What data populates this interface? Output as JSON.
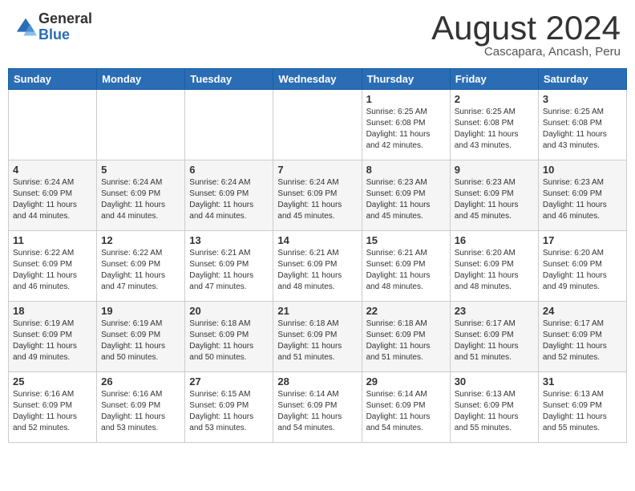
{
  "header": {
    "logo_line1": "General",
    "logo_line2": "Blue",
    "month_title": "August 2024",
    "subtitle": "Cascapara, Ancash, Peru"
  },
  "days_of_week": [
    "Sunday",
    "Monday",
    "Tuesday",
    "Wednesday",
    "Thursday",
    "Friday",
    "Saturday"
  ],
  "weeks": [
    [
      {
        "day": "",
        "info": ""
      },
      {
        "day": "",
        "info": ""
      },
      {
        "day": "",
        "info": ""
      },
      {
        "day": "",
        "info": ""
      },
      {
        "day": "1",
        "info": "Sunrise: 6:25 AM\nSunset: 6:08 PM\nDaylight: 11 hours\nand 42 minutes."
      },
      {
        "day": "2",
        "info": "Sunrise: 6:25 AM\nSunset: 6:08 PM\nDaylight: 11 hours\nand 43 minutes."
      },
      {
        "day": "3",
        "info": "Sunrise: 6:25 AM\nSunset: 6:08 PM\nDaylight: 11 hours\nand 43 minutes."
      }
    ],
    [
      {
        "day": "4",
        "info": "Sunrise: 6:24 AM\nSunset: 6:09 PM\nDaylight: 11 hours\nand 44 minutes."
      },
      {
        "day": "5",
        "info": "Sunrise: 6:24 AM\nSunset: 6:09 PM\nDaylight: 11 hours\nand 44 minutes."
      },
      {
        "day": "6",
        "info": "Sunrise: 6:24 AM\nSunset: 6:09 PM\nDaylight: 11 hours\nand 44 minutes."
      },
      {
        "day": "7",
        "info": "Sunrise: 6:24 AM\nSunset: 6:09 PM\nDaylight: 11 hours\nand 45 minutes."
      },
      {
        "day": "8",
        "info": "Sunrise: 6:23 AM\nSunset: 6:09 PM\nDaylight: 11 hours\nand 45 minutes."
      },
      {
        "day": "9",
        "info": "Sunrise: 6:23 AM\nSunset: 6:09 PM\nDaylight: 11 hours\nand 45 minutes."
      },
      {
        "day": "10",
        "info": "Sunrise: 6:23 AM\nSunset: 6:09 PM\nDaylight: 11 hours\nand 46 minutes."
      }
    ],
    [
      {
        "day": "11",
        "info": "Sunrise: 6:22 AM\nSunset: 6:09 PM\nDaylight: 11 hours\nand 46 minutes."
      },
      {
        "day": "12",
        "info": "Sunrise: 6:22 AM\nSunset: 6:09 PM\nDaylight: 11 hours\nand 47 minutes."
      },
      {
        "day": "13",
        "info": "Sunrise: 6:21 AM\nSunset: 6:09 PM\nDaylight: 11 hours\nand 47 minutes."
      },
      {
        "day": "14",
        "info": "Sunrise: 6:21 AM\nSunset: 6:09 PM\nDaylight: 11 hours\nand 48 minutes."
      },
      {
        "day": "15",
        "info": "Sunrise: 6:21 AM\nSunset: 6:09 PM\nDaylight: 11 hours\nand 48 minutes."
      },
      {
        "day": "16",
        "info": "Sunrise: 6:20 AM\nSunset: 6:09 PM\nDaylight: 11 hours\nand 48 minutes."
      },
      {
        "day": "17",
        "info": "Sunrise: 6:20 AM\nSunset: 6:09 PM\nDaylight: 11 hours\nand 49 minutes."
      }
    ],
    [
      {
        "day": "18",
        "info": "Sunrise: 6:19 AM\nSunset: 6:09 PM\nDaylight: 11 hours\nand 49 minutes."
      },
      {
        "day": "19",
        "info": "Sunrise: 6:19 AM\nSunset: 6:09 PM\nDaylight: 11 hours\nand 50 minutes."
      },
      {
        "day": "20",
        "info": "Sunrise: 6:18 AM\nSunset: 6:09 PM\nDaylight: 11 hours\nand 50 minutes."
      },
      {
        "day": "21",
        "info": "Sunrise: 6:18 AM\nSunset: 6:09 PM\nDaylight: 11 hours\nand 51 minutes."
      },
      {
        "day": "22",
        "info": "Sunrise: 6:18 AM\nSunset: 6:09 PM\nDaylight: 11 hours\nand 51 minutes."
      },
      {
        "day": "23",
        "info": "Sunrise: 6:17 AM\nSunset: 6:09 PM\nDaylight: 11 hours\nand 51 minutes."
      },
      {
        "day": "24",
        "info": "Sunrise: 6:17 AM\nSunset: 6:09 PM\nDaylight: 11 hours\nand 52 minutes."
      }
    ],
    [
      {
        "day": "25",
        "info": "Sunrise: 6:16 AM\nSunset: 6:09 PM\nDaylight: 11 hours\nand 52 minutes."
      },
      {
        "day": "26",
        "info": "Sunrise: 6:16 AM\nSunset: 6:09 PM\nDaylight: 11 hours\nand 53 minutes."
      },
      {
        "day": "27",
        "info": "Sunrise: 6:15 AM\nSunset: 6:09 PM\nDaylight: 11 hours\nand 53 minutes."
      },
      {
        "day": "28",
        "info": "Sunrise: 6:14 AM\nSunset: 6:09 PM\nDaylight: 11 hours\nand 54 minutes."
      },
      {
        "day": "29",
        "info": "Sunrise: 6:14 AM\nSunset: 6:09 PM\nDaylight: 11 hours\nand 54 minutes."
      },
      {
        "day": "30",
        "info": "Sunrise: 6:13 AM\nSunset: 6:09 PM\nDaylight: 11 hours\nand 55 minutes."
      },
      {
        "day": "31",
        "info": "Sunrise: 6:13 AM\nSunset: 6:09 PM\nDaylight: 11 hours\nand 55 minutes."
      }
    ]
  ]
}
